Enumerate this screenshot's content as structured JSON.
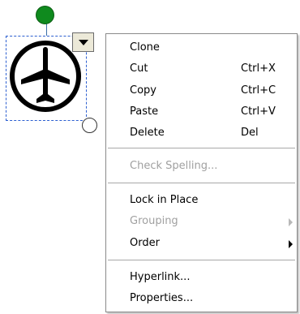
{
  "canvas": {
    "shape_icon": "airplane-icon",
    "rotate_handle_color": "#0f8a1e",
    "selection_color": "#2c5fd0"
  },
  "menu_button": {
    "icon": "dropdown-triangle-icon"
  },
  "context_menu": {
    "items": [
      {
        "label": "Clone",
        "shortcut": ""
      },
      {
        "label": "Cut",
        "shortcut": "Ctrl+X"
      },
      {
        "label": "Copy",
        "shortcut": "Ctrl+C"
      },
      {
        "label": "Paste",
        "shortcut": "Ctrl+V"
      },
      {
        "label": "Delete",
        "shortcut": "Del"
      },
      {
        "label": "Check Spelling...",
        "disabled": true
      },
      {
        "label": "Lock in Place"
      },
      {
        "label": "Grouping",
        "disabled": true,
        "submenu": true
      },
      {
        "label": "Order",
        "submenu": true
      },
      {
        "label": "Hyperlink..."
      },
      {
        "label": "Properties..."
      }
    ]
  }
}
